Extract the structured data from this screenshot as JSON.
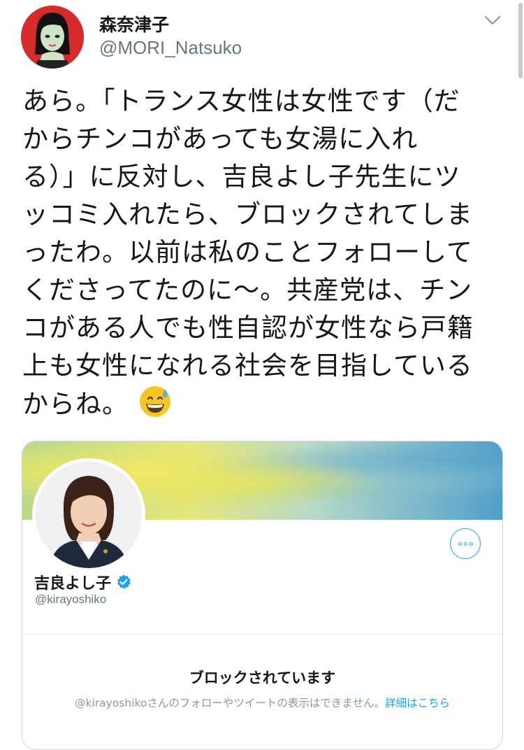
{
  "tweet": {
    "author_name": "森奈津子",
    "author_handle": "@MORI_Natsuko",
    "lines": [
      "あら。「トランス女性は女性です（だ",
      "からチンコがあっても女湯に入れ",
      "る）」に反対し、吉良よし子先生にツ",
      "ッコミ入れたら、ブロックされてしま",
      "ったわ。以前は私のことフォローして",
      "くださってたのに〜。共産党は、チン",
      "コがある人でも性自認が女性なら戸籍",
      "上も女性になれる社会を目指している",
      "からね。"
    ],
    "emoji": "grinning-face-with-sweat"
  },
  "embedded_profile": {
    "name": "吉良よし子",
    "handle": "@kirayoshiko",
    "verified": true,
    "blocked_title": "ブロックされています",
    "blocked_description": "@kirayoshikoさんのフォローやツイートの表示はできません。",
    "learn_more": "詳細はこちら"
  },
  "colors": {
    "accent": "#1da1f2",
    "text": "#14171a",
    "secondary_text": "#657786",
    "border": "#ccd6dd"
  }
}
